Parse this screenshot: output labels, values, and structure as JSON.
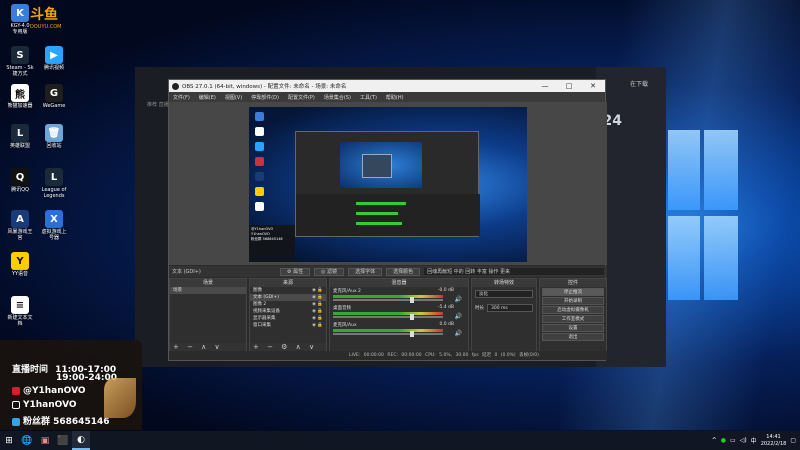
{
  "desktop": {
    "douyu_logo": "斗鱼",
    "douyu_url": "DOUYU.COM",
    "icons": [
      {
        "label": "KGY-4.0\n专用版",
        "color": "#3b7dd8",
        "glyph": "K"
      },
      {
        "label": "Steam - Sk\n捷方式",
        "color": "#1b2838",
        "glyph": "S"
      },
      {
        "label": "腾讯视频",
        "color": "#2aa5ff",
        "glyph": "▶"
      },
      {
        "label": "熊猫加速器",
        "color": "#ffffff",
        "glyph": "熊"
      },
      {
        "label": "WeGame",
        "color": "#1e1e1e",
        "glyph": "G"
      },
      {
        "label": "英雄联盟",
        "color": "#1b2a3a",
        "glyph": "L"
      },
      {
        "label": "回收站",
        "color": "#6fa6d8",
        "glyph": "🗑"
      },
      {
        "label": "腾讯QQ",
        "color": "#111111",
        "glyph": "Q"
      },
      {
        "label": "League of\nLegends",
        "color": "#1b2a3a",
        "glyph": "L"
      },
      {
        "label": "风暴游戏王\n官",
        "color": "#1a3b7a",
        "glyph": "A"
      },
      {
        "label": "虚拟游戏上\n号器",
        "color": "#2b6fd8",
        "glyph": "X"
      },
      {
        "label": "YY语音",
        "color": "#ffcc00",
        "glyph": "Y"
      },
      {
        "label": "新建文本文\n档",
        "color": "#ffffff",
        "glyph": "≡"
      }
    ]
  },
  "background_app": {
    "download_text": "在下载",
    "counter": "24",
    "room_text": "推荐 直播间"
  },
  "obs": {
    "title": "OBS 27.0.1 (64-bit, windows) - 配置文件: 未命名 - 场景: 未命名",
    "menu": [
      "文件(F)",
      "编辑(E)",
      "视图(V)",
      "停靠部件(D)",
      "配置文件(P)",
      "场景集合(S)",
      "工具(T)",
      "帮助(H)"
    ],
    "window_buttons": {
      "minimize": "—",
      "maximize": "□",
      "close": "✕"
    },
    "context_bar": {
      "source": "文本 (GDI+)",
      "properties": "属性",
      "filters": "滤镜",
      "font_btn": "选择字体",
      "color_btn": "选择颜色",
      "text_field": "回魂再献短 中的 回转 丰富 操作 更来"
    },
    "scenes": {
      "header": "场景",
      "items": [
        "场景"
      ]
    },
    "sources": {
      "header": "来源",
      "items": [
        "图像",
        "文本 (GDI+)",
        "图像 2",
        "视频采集设备",
        "显示器采集",
        "窗口采集"
      ]
    },
    "mixer": {
      "header": "混音器",
      "channels": [
        {
          "name": "麦克风/Aux 2",
          "level": "-0.0 dB"
        },
        {
          "name": "桌面音频",
          "level": "-5.4 dB"
        },
        {
          "name": "麦克风/Aux",
          "level": "0.0 dB"
        }
      ]
    },
    "transitions": {
      "header": "转场特效",
      "type": "淡化",
      "duration_label": "时长",
      "duration_value": "300 ms"
    },
    "controls": {
      "header": "控件",
      "buttons": [
        "停止推流",
        "开始录制",
        "启动虚拟摄像机",
        "工作室模式",
        "设置",
        "退出"
      ]
    },
    "status": {
      "live": "LIVE: 00:00:00",
      "rec": "REC: 00:00:00",
      "cpu": "CPU: 5.0%, 30.00 fps",
      "dropped": "延迟 0 (0.0%) 丢帧(0/0)"
    },
    "preview_overlay": [
      "@Y1hanOVO",
      "Y1hanOVO",
      "粉丝群 568645146"
    ]
  },
  "streamer": {
    "schedule_label": "直播时间",
    "time1": "11:00-17:00",
    "time2": "19:00-24:00",
    "weibo": "@Y1hanOVO",
    "douyin": "Y1hanOVO",
    "fans": "粉丝群 568645146"
  },
  "taskbar": {
    "start_glyph": "⊞",
    "apps": [
      "🌐",
      "▣",
      "⬛",
      "◐"
    ],
    "time": "14:41",
    "date": "2022/2/18",
    "tray_lang": "中"
  }
}
